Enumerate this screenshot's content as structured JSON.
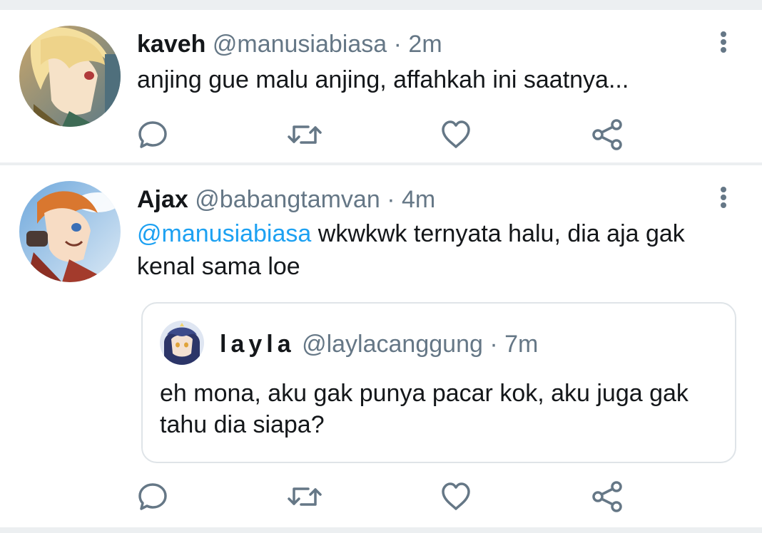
{
  "tweets": [
    {
      "name": "kaveh",
      "handle": "@manusiabiasa",
      "separator": "·",
      "time": "2m",
      "text": "anjing gue malu anjing, affahkah ini saatnya..."
    },
    {
      "name": "Ajax",
      "handle": "@babangtamvan",
      "separator": "·",
      "time": "4m",
      "mention": "@manusiabiasa",
      "text": " wkwkwk ternyata halu, dia aja gak kenal sama loe",
      "quote": {
        "name": "layla",
        "handle": "@laylacanggung",
        "separator": "·",
        "time": "7m",
        "text": "eh mona, aku gak punya pacar kok, aku juga gak tahu dia siapa?"
      }
    }
  ],
  "icons": {
    "reply": "reply-icon",
    "retweet": "retweet-icon",
    "like": "heart-icon",
    "share": "share-icon",
    "more": "more-vertical-icon"
  },
  "colors": {
    "mention": "#1da1f2",
    "secondary_text": "#657786",
    "divider": "#eceff1"
  }
}
